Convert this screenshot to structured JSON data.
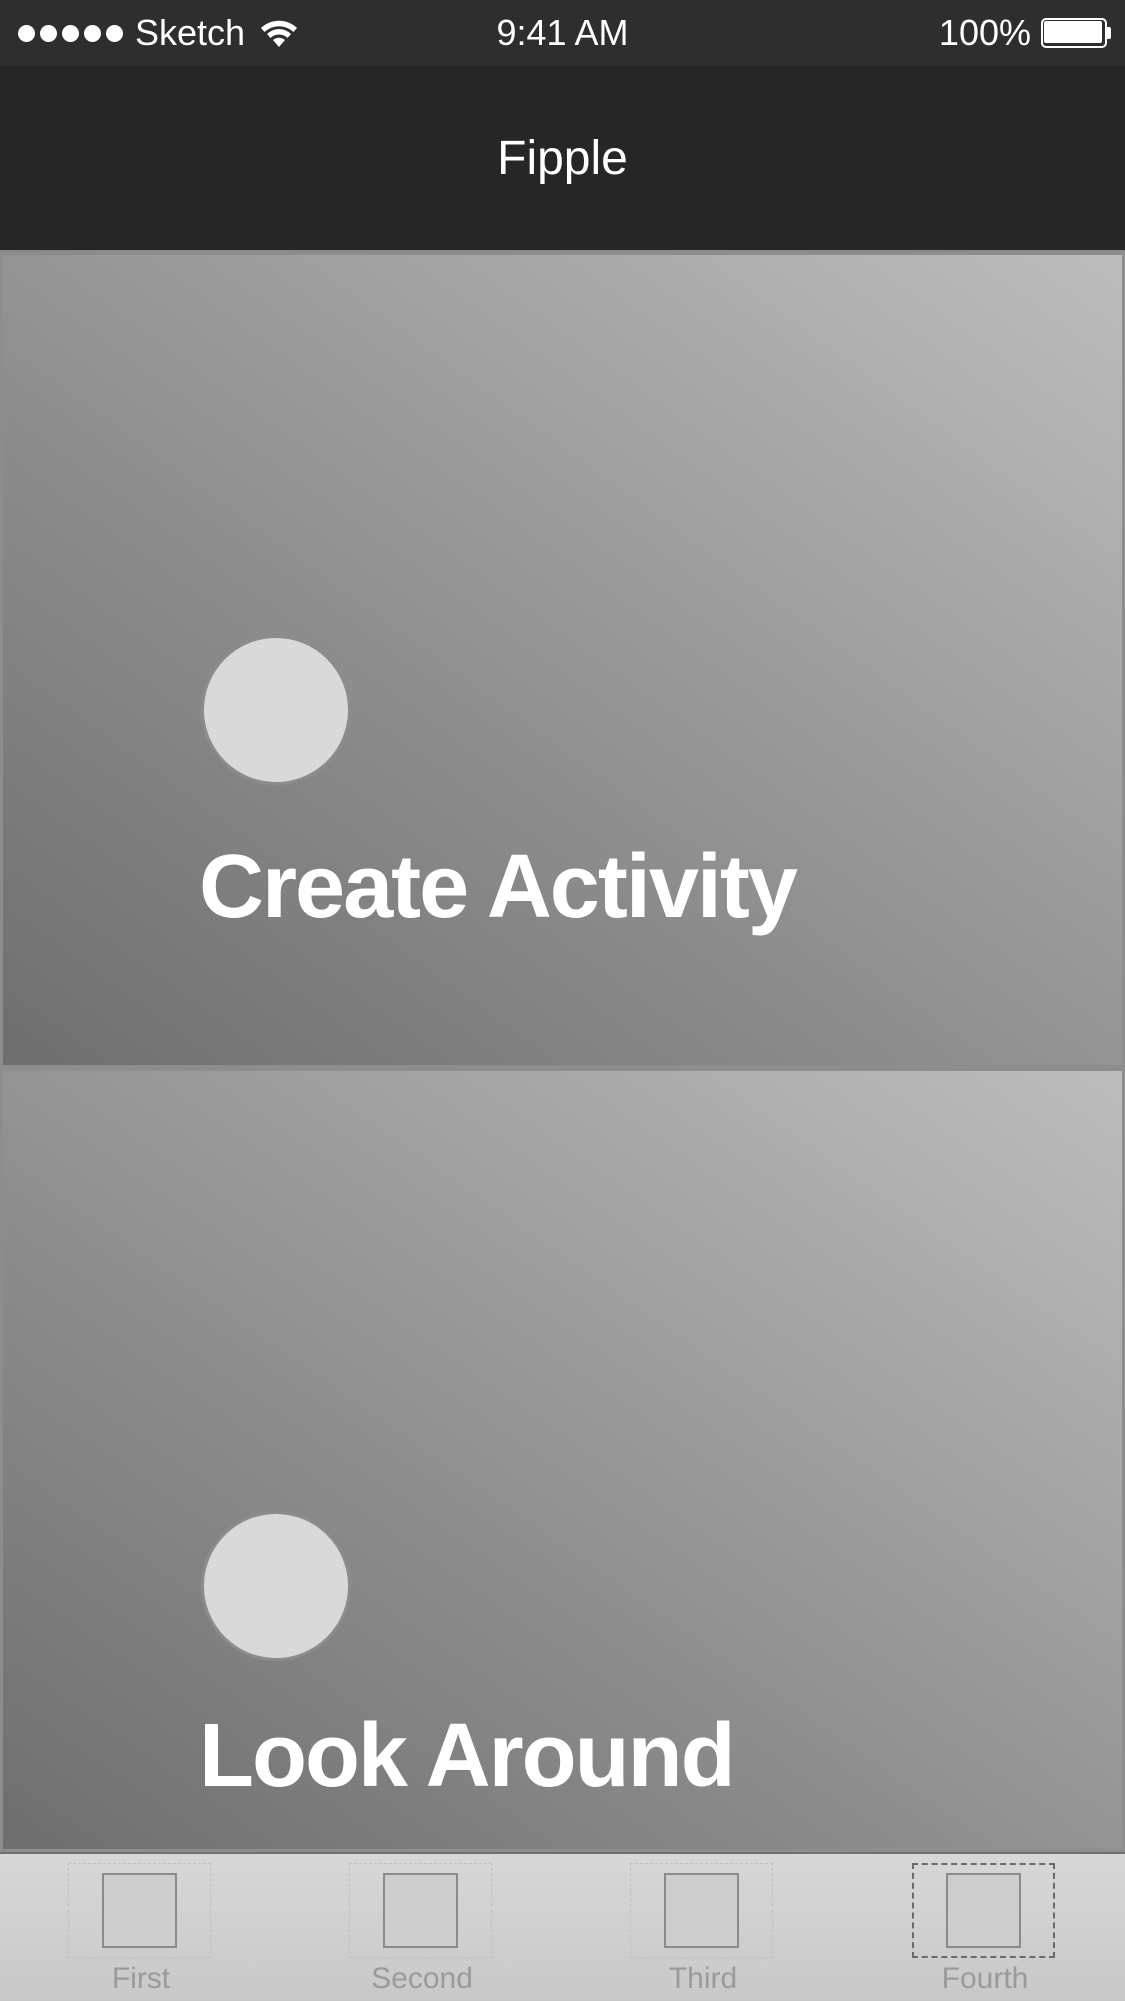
{
  "status_bar": {
    "carrier": "Sketch",
    "time": "9:41 AM",
    "battery": "100%",
    "signal_icon": "signal-dots-icon",
    "wifi_icon": "wifi-icon",
    "battery_icon": "battery-icon",
    "battery_level": 1.0
  },
  "nav": {
    "title": "Fipple"
  },
  "cards": [
    {
      "label": "Create Activity",
      "icon": "avatar-placeholder"
    },
    {
      "label": "Look Around",
      "icon": "avatar-placeholder"
    }
  ],
  "tab_bar": {
    "items": [
      {
        "label": "First",
        "icon": "square-icon",
        "selected": false
      },
      {
        "label": "Second",
        "icon": "square-icon",
        "selected": false
      },
      {
        "label": "Third",
        "icon": "square-icon",
        "selected": false
      },
      {
        "label": "Fourth",
        "icon": "square-icon",
        "selected": true
      }
    ]
  },
  "colors": {
    "nav_background": "#262626",
    "status_background": "#2e2e2e",
    "card_gradient_dark": "#6e6e6e",
    "card_gradient_light": "#bdbdbd",
    "avatar_fill": "#d9d9d9",
    "tab_label": "#9a9a9a",
    "text_light": "#ffffff"
  }
}
